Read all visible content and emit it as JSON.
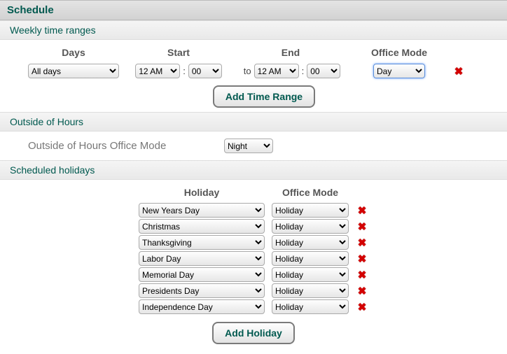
{
  "title": "Schedule",
  "weekly": {
    "section": "Weekly time ranges",
    "headers": {
      "days": "Days",
      "start": "Start",
      "end": "End",
      "mode": "Office Mode"
    },
    "row": {
      "days": "All days",
      "start_h": "12 AM",
      "start_m": "00",
      "end_h": "12 AM",
      "end_m": "00",
      "mode": "Day",
      "colon": ":",
      "to": "to"
    },
    "add_label": "Add Time Range"
  },
  "outside": {
    "section": "Outside of Hours",
    "label": "Outside of Hours Office Mode",
    "mode": "Night"
  },
  "holidays": {
    "section": "Scheduled holidays",
    "headers": {
      "holiday": "Holiday",
      "mode": "Office Mode"
    },
    "rows": [
      {
        "name": "New Years Day",
        "mode": "Holiday"
      },
      {
        "name": "Christmas",
        "mode": "Holiday"
      },
      {
        "name": "Thanksgiving",
        "mode": "Holiday"
      },
      {
        "name": "Labor Day",
        "mode": "Holiday"
      },
      {
        "name": "Memorial Day",
        "mode": "Holiday"
      },
      {
        "name": "Presidents Day",
        "mode": "Holiday"
      },
      {
        "name": "Independence Day",
        "mode": "Holiday"
      }
    ],
    "add_label": "Add Holiday"
  }
}
